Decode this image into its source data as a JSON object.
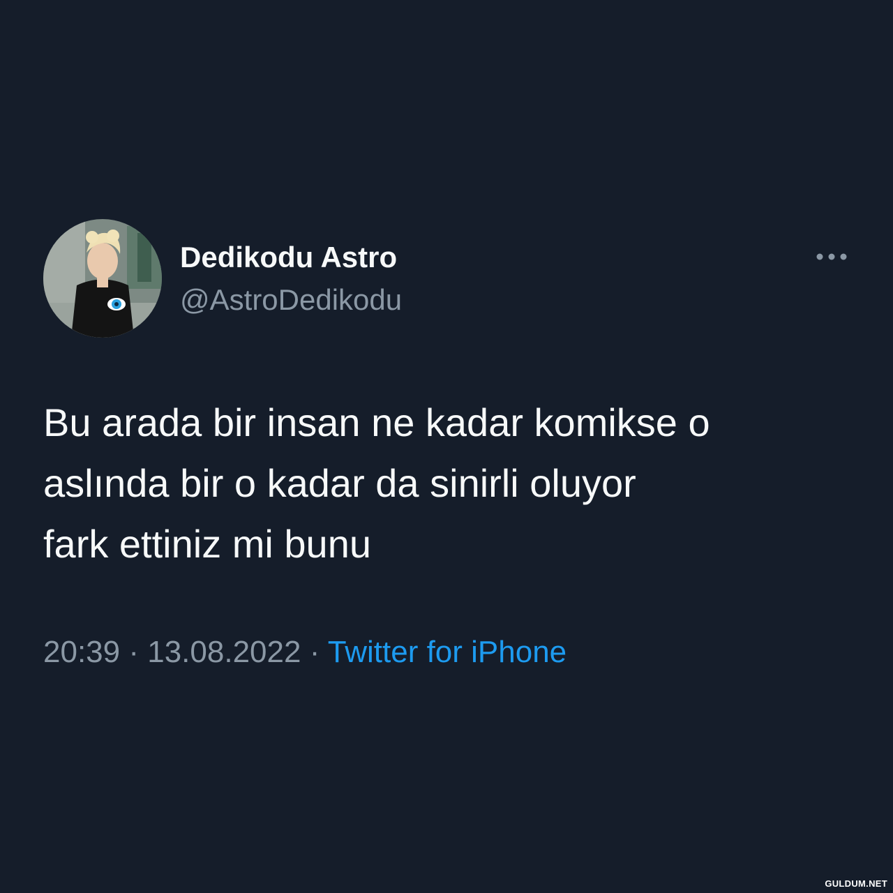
{
  "author": {
    "display_name": "Dedikodu Astro",
    "handle": "@AstroDedikodu",
    "avatar_icon": "profile-photo"
  },
  "more_icon": "ellipsis-icon",
  "tweet": {
    "lines": [
      "Bu arada bir insan ne kadar komikse o",
      "aslında bir o kadar da sinirli oluyor",
      "fark ettiniz mi bunu"
    ]
  },
  "meta": {
    "time": "20:39",
    "separator": "·",
    "date": "13.08.2022",
    "source": "Twitter for iPhone"
  },
  "watermark": "GULDUM.NET",
  "colors": {
    "background": "#151d2a",
    "text_primary": "#f7f9f9",
    "text_secondary": "#8b98a5",
    "link": "#1d9bf0"
  }
}
